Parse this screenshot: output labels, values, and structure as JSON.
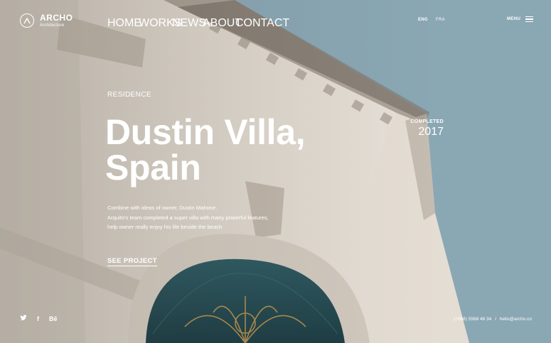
{
  "brand": {
    "name": "ARCHO",
    "tagline": "Architecture"
  },
  "nav": {
    "items": [
      "HOME",
      "WORKS",
      "NEWS",
      "ABOUT",
      "CONTACT"
    ]
  },
  "languages": [
    "ENG",
    "FRA"
  ],
  "menu": {
    "label": "MENU"
  },
  "hero": {
    "category": "RESIDENCE",
    "title_line1": "Dustin Villa,",
    "title_line2": "Spain",
    "description": [
      "Combine with ideas of owner, Dustin Mahone.",
      "Arquito's team completed a super villa with many powerful features,",
      "help owner really enjoy his life beside the beach"
    ],
    "cta_label": "SEE PROJECT",
    "status_label": "COMPLETED",
    "status_year": "2017"
  },
  "social": [
    {
      "icon": "twitter-icon",
      "glyph": "🐦"
    },
    {
      "icon": "facebook-icon",
      "glyph": "f"
    },
    {
      "icon": "behance-icon",
      "glyph": "Bē"
    }
  ],
  "contact": {
    "phone": "(+088) 5568 48 34",
    "separator": "/",
    "email": "hello@archo.co"
  },
  "colors": {
    "sky": "#8aa7b4",
    "stone": "#d8d0c6",
    "text": "#ffffff"
  }
}
